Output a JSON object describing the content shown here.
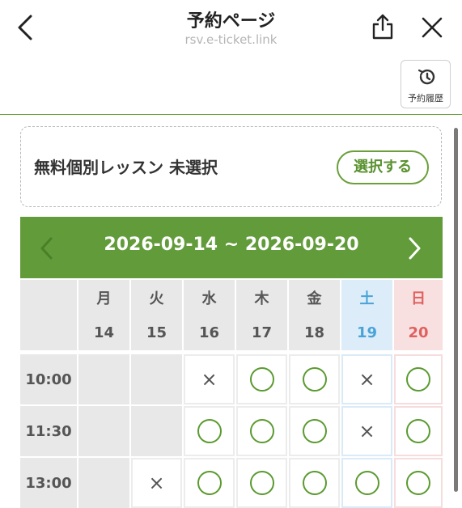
{
  "header": {
    "title": "予約ページ",
    "url": "rsv.e-ticket.link"
  },
  "history_button": {
    "label": "予約履歴"
  },
  "lesson": {
    "text": "無料個別レッスン 未選択",
    "select_label": "選択する"
  },
  "week": {
    "range": "2026-09-14 ~ 2026-09-20",
    "days": [
      {
        "name": "月",
        "date": "14",
        "kind": "weekday"
      },
      {
        "name": "火",
        "date": "15",
        "kind": "weekday"
      },
      {
        "name": "水",
        "date": "16",
        "kind": "weekday"
      },
      {
        "name": "木",
        "date": "17",
        "kind": "weekday"
      },
      {
        "name": "金",
        "date": "18",
        "kind": "weekday"
      },
      {
        "name": "土",
        "date": "19",
        "kind": "sat"
      },
      {
        "name": "日",
        "date": "20",
        "kind": "sun"
      }
    ]
  },
  "slots": [
    {
      "time": "10:00",
      "marks": [
        "",
        "",
        "×",
        "○",
        "○",
        "×",
        "○"
      ]
    },
    {
      "time": "11:30",
      "marks": [
        "",
        "",
        "○",
        "○",
        "○",
        "×",
        "○"
      ]
    },
    {
      "time": "13:00",
      "marks": [
        "",
        "×",
        "○",
        "○",
        "○",
        "○",
        "○"
      ]
    }
  ],
  "colors": {
    "accent_green": "#629b3a",
    "saturday": "#4aa3d8",
    "sunday": "#e06060"
  }
}
